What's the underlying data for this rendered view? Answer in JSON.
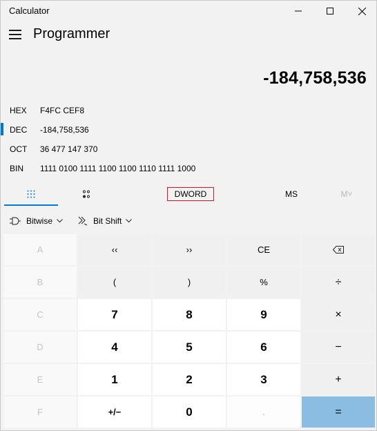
{
  "window": {
    "title": "Calculator",
    "controls": {
      "minimize": "minimize-icon",
      "maximize": "maximize-icon",
      "close": "close-icon"
    }
  },
  "header": {
    "menu_icon": "hamburger-menu-icon",
    "mode": "Programmer"
  },
  "display": {
    "value": "-184,758,536"
  },
  "radix": [
    {
      "label": "HEX",
      "value": "F4FC CEF8",
      "selected": false
    },
    {
      "label": "DEC",
      "value": "-184,758,536",
      "selected": true
    },
    {
      "label": "OCT",
      "value": "36 477 147 370",
      "selected": false
    },
    {
      "label": "BIN",
      "value": "1111 0100 1111 1100 1100 1110 1111 1000",
      "selected": false
    }
  ],
  "tabs": {
    "keypad_icon": "full-keypad-icon",
    "bitpad_icon": "bit-toggling-keypad-icon",
    "word_size": "DWORD",
    "memory_store": "MS",
    "memory_plus": "M˅"
  },
  "bit_ops": {
    "bitwise": "Bitwise",
    "bit_shift": "Bit Shift"
  },
  "keys": {
    "row1": [
      "A",
      "‹‹",
      "››",
      "CE",
      "⌫"
    ],
    "row2": [
      "B",
      "(",
      ")",
      "%",
      "÷"
    ],
    "row3": [
      "C",
      "7",
      "8",
      "9",
      "×"
    ],
    "row4": [
      "D",
      "4",
      "5",
      "6",
      "−"
    ],
    "row5": [
      "E",
      "1",
      "2",
      "3",
      "+"
    ],
    "row6": [
      "F",
      "+/−",
      "0",
      ".",
      "="
    ]
  },
  "colors": {
    "accent": "#0078d4",
    "equals": "#8bbce2",
    "word_size_border": "#e81123"
  }
}
